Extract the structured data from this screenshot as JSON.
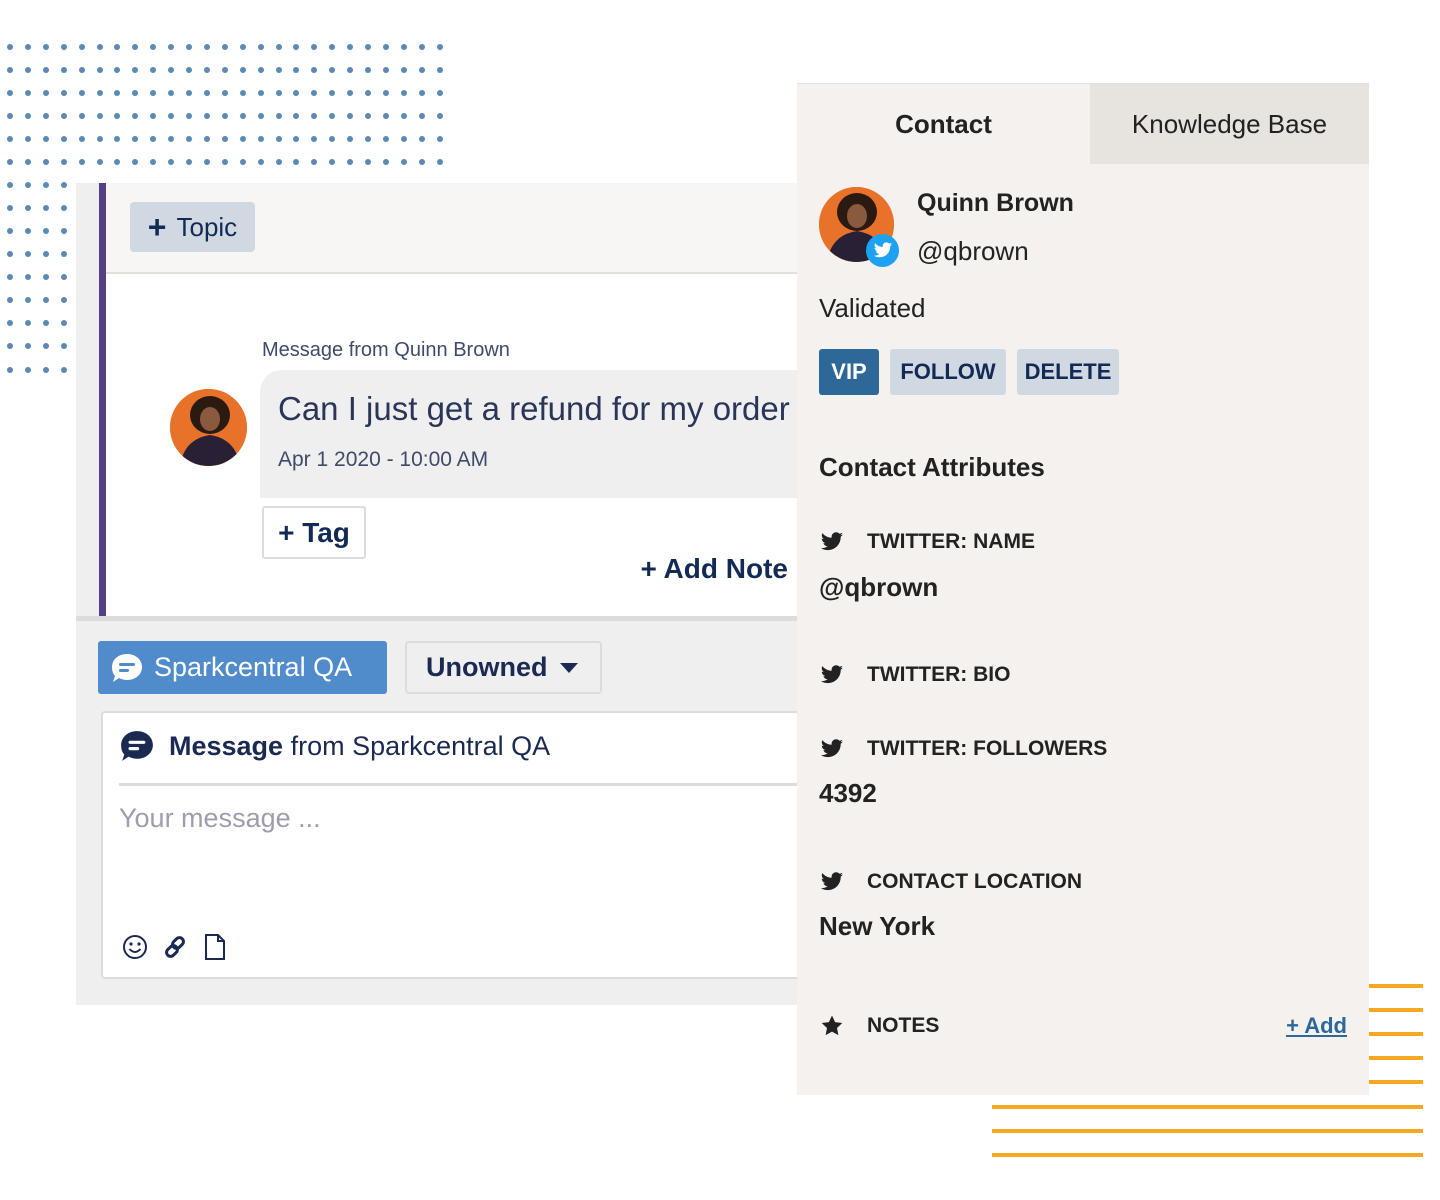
{
  "conversation": {
    "topic_button": {
      "icon": "plus-icon",
      "label": "Topic"
    },
    "message": {
      "from_label": "Message from Quinn Brown",
      "text": "Can I just get a refund for my order",
      "timestamp": "Apr 1 2020 - 10:00 AM"
    },
    "tag_button": "+ Tag",
    "add_note_button": "+ Add Note"
  },
  "composer": {
    "channel_button": {
      "icon": "chat-bubble-icon",
      "label": "Sparkcentral QA"
    },
    "owner_select": {
      "value": "Unowned",
      "icon": "caret-down-icon"
    },
    "header": {
      "prefix": "Message",
      "middle": " from ",
      "source": "Sparkcentral QA"
    },
    "input": {
      "value": "",
      "placeholder": "Your message ..."
    },
    "tools": [
      {
        "name": "emoji",
        "icon": "smiley-icon"
      },
      {
        "name": "link",
        "icon": "link-icon"
      },
      {
        "name": "attachment",
        "icon": "file-icon"
      }
    ]
  },
  "contact_panel": {
    "tabs": [
      {
        "label": "Contact",
        "active": true
      },
      {
        "label": "Knowledge Base",
        "active": false
      }
    ],
    "contact": {
      "name": "Quinn Brown",
      "handle": "@qbrown",
      "channel_badge": "twitter-icon",
      "status": "Validated"
    },
    "actions": [
      {
        "label": "VIP",
        "active": true
      },
      {
        "label": "FOLLOW",
        "active": false
      },
      {
        "label": "DELETE",
        "active": false
      }
    ],
    "attributes_title": "Contact Attributes",
    "attributes": [
      {
        "icon": "twitter-icon",
        "label": "TWITTER: NAME",
        "value": "@qbrown"
      },
      {
        "icon": "twitter-icon",
        "label": "TWITTER: BIO",
        "value": ""
      },
      {
        "icon": "twitter-icon",
        "label": "TWITTER: FOLLOWERS",
        "value": "4392"
      },
      {
        "icon": "twitter-icon",
        "label": "CONTACT LOCATION",
        "value": "New York"
      }
    ],
    "notes": {
      "icon": "star-icon",
      "label": "NOTES",
      "add_link": "+ Add"
    }
  },
  "colors": {
    "accent_purple": "#553f82",
    "channel_blue": "#508ccb",
    "vip_blue": "#2e6899",
    "twitter_blue": "#1da1f2",
    "deco_dots": "#5b8ab5",
    "deco_lines": "#f6a821",
    "navy_text": "#132a55"
  }
}
